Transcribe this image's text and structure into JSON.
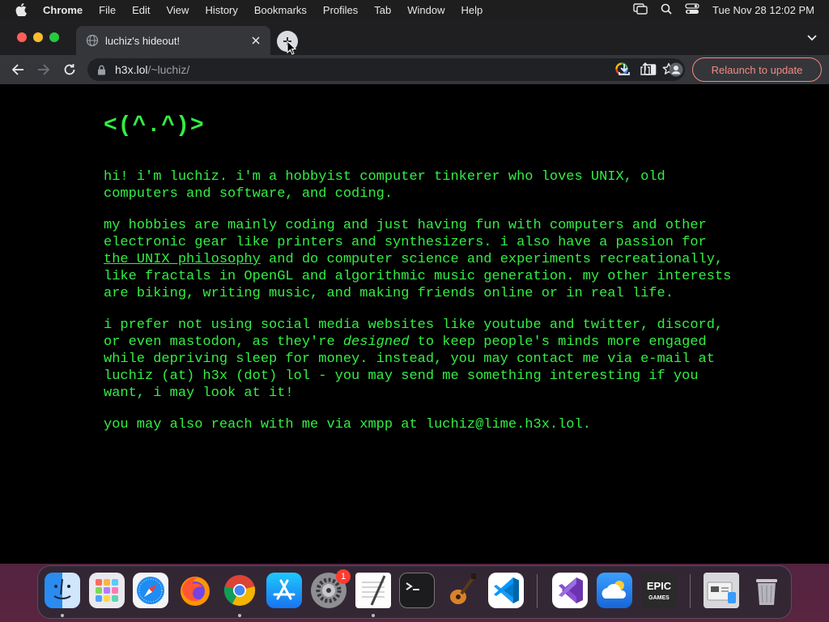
{
  "menubar": {
    "app": "Chrome",
    "items": [
      "File",
      "Edit",
      "View",
      "History",
      "Bookmarks",
      "Profiles",
      "Tab",
      "Window",
      "Help"
    ],
    "clock": "Tue Nov 28  12:02 PM"
  },
  "browser": {
    "tab_title": "luchiz's hideout!",
    "url_host": "h3x.lol",
    "url_path": "/~luchiz/",
    "relaunch_label": "Relaunch to update"
  },
  "page": {
    "logo": "<(^.^)>",
    "p1": "hi! i'm luchiz. i'm a hobbyist computer tinkerer who loves UNIX, old computers and software, and coding.",
    "p2_before": "my hobbies are mainly coding and just having fun with computers and other electronic gear like printers and synthesizers. i also have a passion for ",
    "p2_link": "the UNIX philosophy",
    "p2_after": " and do computer science and experiments recreationally, like fractals in OpenGL and algorithmic music generation. my other interests are biking, writing music, and making friends online or in real life.",
    "p3_before": "i prefer not using social media websites like youtube and twitter, discord, or even mastodon, as they're ",
    "p3_em": "designed",
    "p3_after": " to keep people's minds more engaged while depriving sleep for money. instead, you may contact me via e-mail at luchiz (at) h3x (dot) lol - you may send me something interesting if you want, i may look at it!",
    "p4": "you may also reach with me via xmpp at luchiz@lime.h3x.lol."
  },
  "dock": {
    "apps": [
      "finder-icon",
      "launchpad-icon",
      "safari-icon",
      "firefox-icon",
      "chrome-icon",
      "app-store-icon",
      "system-settings-icon",
      "textedit-icon",
      "terminal-icon",
      "garageband-icon",
      "vscode-icon",
      "visual-studio-icon",
      "cloud-app-icon",
      "epic-games-icon",
      "preview-icon",
      "trash-icon"
    ],
    "settings_badge": "1",
    "epic_label_top": "EPIC",
    "epic_label_bottom": "GAMES"
  },
  "colors": {
    "page_bg": "#000000",
    "text_green": "#33ee44",
    "relaunch_red": "#f28b82"
  }
}
